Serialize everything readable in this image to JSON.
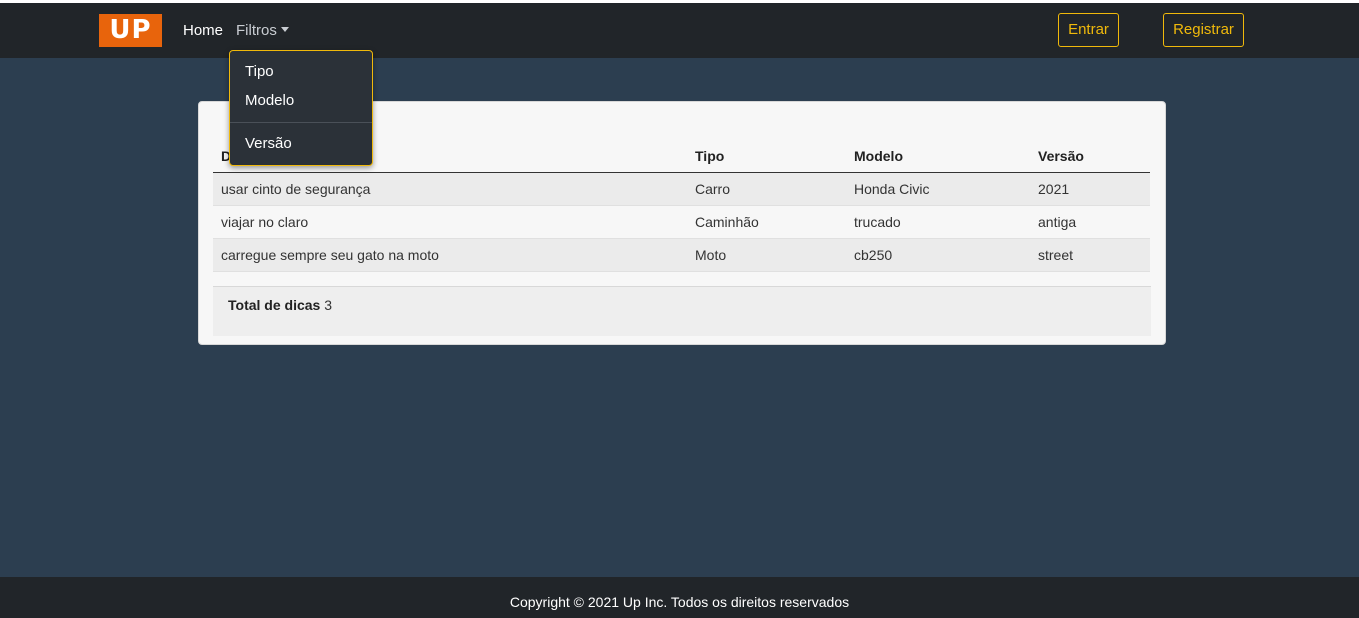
{
  "nav": {
    "logo_text": "UP",
    "home": "Home",
    "filtros": "Filtros",
    "entrar": "Entrar",
    "registrar": "Registrar"
  },
  "dropdown": {
    "items": [
      "Tipo",
      "Modelo",
      "Versão"
    ]
  },
  "table": {
    "headers": [
      "Dica",
      "Tipo",
      "Modelo",
      "Versão"
    ],
    "rows": [
      [
        "usar cinto de segurança",
        "Carro",
        "Honda Civic",
        "2021"
      ],
      [
        "viajar no claro",
        "Caminhão",
        "trucado",
        "antiga"
      ],
      [
        "carregue sempre seu gato na moto",
        "Moto",
        "cb250",
        "street"
      ]
    ]
  },
  "total": {
    "label": "Total de dicas",
    "value": "3"
  },
  "footer": {
    "text": "Copyright © 2021 Up Inc. Todos os direitos reservados"
  },
  "colors": {
    "background": "#2c3e50",
    "navbar": "#212529",
    "accent": "#f0b90b",
    "logo": "#e8640c"
  }
}
